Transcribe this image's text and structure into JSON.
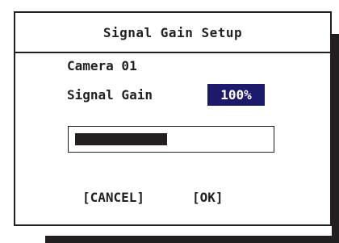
{
  "dialog": {
    "title": "Signal Gain Setup",
    "camera_label": "Camera 01",
    "signal_gain_label": "Signal Gain",
    "signal_gain_value": "100%",
    "progress_fraction": 0.48,
    "cancel_label": "[CANCEL]",
    "ok_label": "[OK]"
  },
  "colors": {
    "foreground": "#231f20",
    "highlight": "#1d1a6b",
    "background": "#ffffff"
  }
}
